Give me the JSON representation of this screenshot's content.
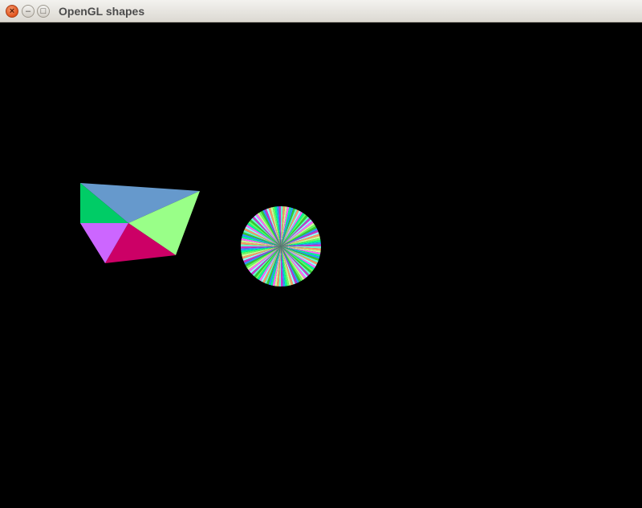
{
  "window": {
    "title": "OpenGL shapes",
    "close_glyph": "×",
    "minimize_glyph": "–",
    "maximize_glyph": "□"
  },
  "scene": {
    "background": "#000000",
    "fan_shape_colors": [
      "#6699cc",
      "#99ff88",
      "#cc0066",
      "#cc66ff",
      "#00cc66"
    ],
    "circle_spoke_palette": [
      "#66ffcc",
      "#ff66ff",
      "#33cc33",
      "#99ffff",
      "#66ff66",
      "#cc33cc",
      "#ccff99",
      "#3399ff",
      "#ff9966",
      "#00ff99"
    ]
  }
}
